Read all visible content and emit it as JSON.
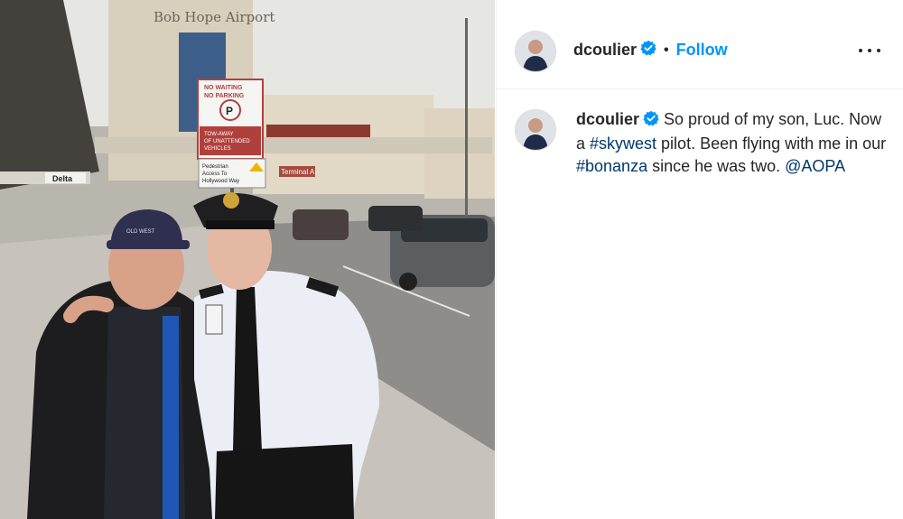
{
  "post": {
    "username": "dcoulier",
    "follow_label": "Follow",
    "separator": "•",
    "caption": {
      "part1": " So proud of my son, Luc. Now a ",
      "hashtag1": "#skywest",
      "part2": " pilot. Been flying with me in our ",
      "hashtag2": "#bonanza",
      "part3": " since he was two. ",
      "mention": "@AOPA"
    }
  },
  "photo": {
    "airport_sign": "Bob Hope Airport",
    "sign_no_parking": [
      "NO WAITING",
      "NO PARKING"
    ],
    "sign_tow": [
      "TOW-AWAY",
      "OF UNATTENDED",
      "VEHICLES"
    ],
    "sign_pedestrian": [
      "Pedestrian",
      "Access To",
      "Hollywood Way"
    ],
    "sign_delta": "Delta",
    "sign_terminal": "Terminal A",
    "hat_text": "OLD WEST"
  },
  "colors": {
    "accent": "#0095f6",
    "link": "#00376b",
    "verified": "#0095f6"
  },
  "icons": {
    "verified": "verified-badge-icon",
    "more": "more-options-icon"
  }
}
